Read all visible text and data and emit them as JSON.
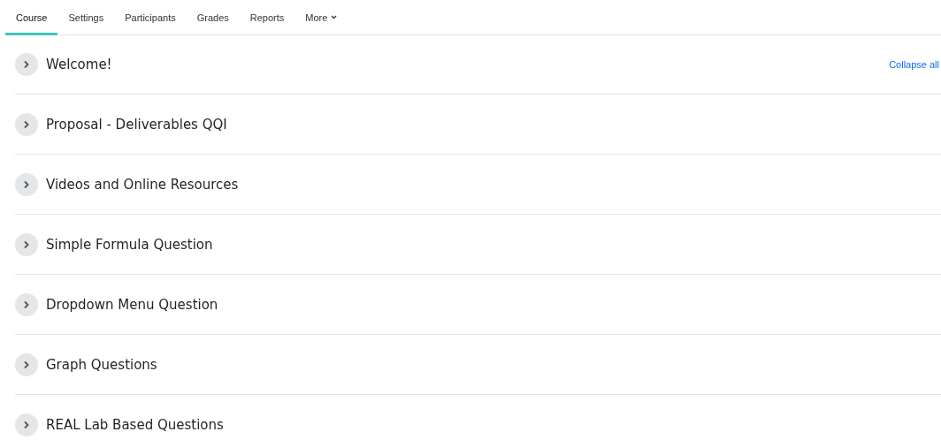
{
  "tabs": [
    {
      "label": "Course",
      "selected": true
    },
    {
      "label": "Settings",
      "selected": false
    },
    {
      "label": "Participants",
      "selected": false
    },
    {
      "label": "Grades",
      "selected": false
    },
    {
      "label": "Reports",
      "selected": false
    },
    {
      "label": "More",
      "selected": false,
      "dropdown": true
    }
  ],
  "collapse_link": "Collapse all",
  "sections": [
    {
      "title": "Welcome!",
      "expanded": false
    },
    {
      "title": "Proposal - Deliverables QQI",
      "expanded": false
    },
    {
      "title": "Videos and Online Resources",
      "expanded": false
    },
    {
      "title": "Simple Formula Question",
      "expanded": false
    },
    {
      "title": "Dropdown Menu Question",
      "expanded": false
    },
    {
      "title": "Graph Questions",
      "expanded": false
    },
    {
      "title": "REAL Lab Based Questions",
      "expanded": false
    }
  ]
}
